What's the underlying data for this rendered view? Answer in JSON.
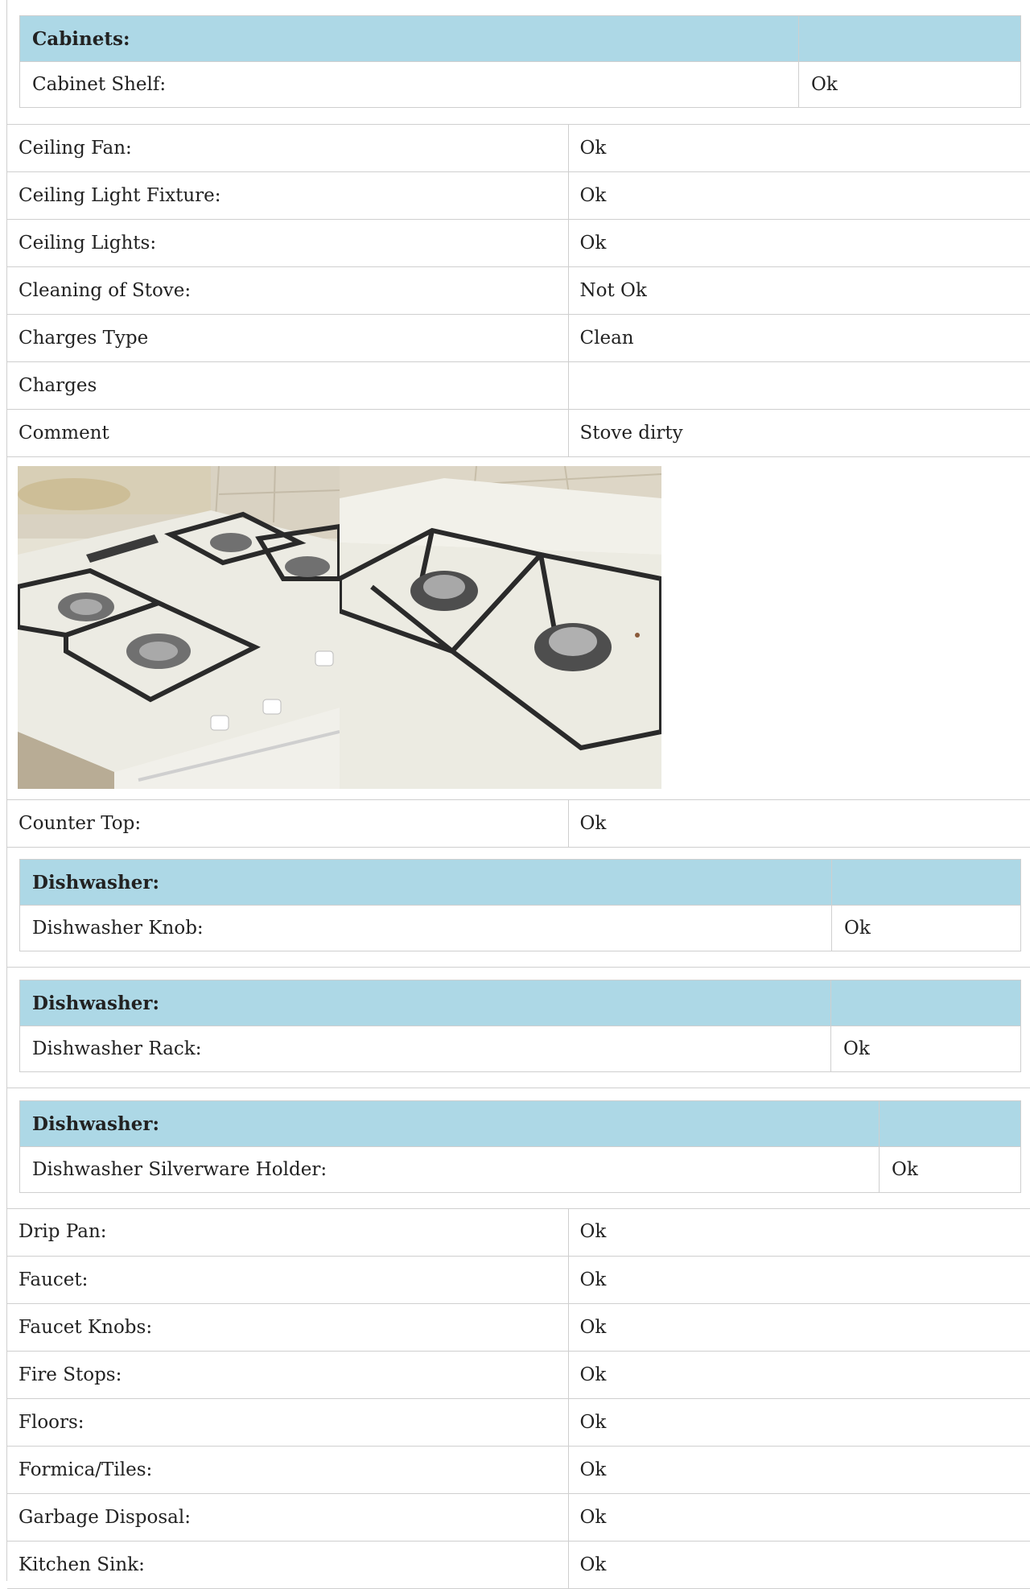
{
  "sections": {
    "cabinets": {
      "header": "Cabinets:",
      "row_label": "Cabinet Shelf:",
      "row_value": "Ok"
    },
    "dishwasher_knob": {
      "header": "Dishwasher:",
      "row_label": "Dishwasher Knob:",
      "row_value": "Ok"
    },
    "dishwasher_rack": {
      "header": "Dishwasher:",
      "row_label": "Dishwasher Rack:",
      "row_value": "Ok"
    },
    "dishwasher_silverware": {
      "header": "Dishwasher:",
      "row_label": "Dishwasher Silverware Holder:",
      "row_value": "Ok"
    }
  },
  "rows_a": [
    {
      "label": "Ceiling Fan:",
      "value": "Ok"
    },
    {
      "label": "Ceiling Light Fixture:",
      "value": "Ok"
    },
    {
      "label": "Ceiling Lights:",
      "value": "Ok"
    },
    {
      "label": "Cleaning of Stove:",
      "value": "Not Ok"
    },
    {
      "label": "Charges Type",
      "value": "Clean"
    },
    {
      "label": "Charges",
      "value": ""
    },
    {
      "label": "Comment",
      "value": "Stove dirty"
    }
  ],
  "row_counter": {
    "label": "Counter Top:",
    "value": "Ok"
  },
  "rows_b": [
    {
      "label": "Drip Pan:",
      "value": "Ok"
    },
    {
      "label": "Faucet:",
      "value": "Ok"
    },
    {
      "label": "Faucet Knobs:",
      "value": "Ok"
    },
    {
      "label": "Fire Stops:",
      "value": "Ok"
    },
    {
      "label": "Floors:",
      "value": "Ok"
    },
    {
      "label": "Formica/Tiles:",
      "value": "Ok"
    },
    {
      "label": "Garbage Disposal:",
      "value": "Ok"
    },
    {
      "label": "Kitchen Sink:",
      "value": "Ok"
    }
  ],
  "photos": [
    {
      "icon": "stove-photo-four-burners"
    },
    {
      "icon": "stove-photo-two-burners-closeup"
    }
  ],
  "colors": {
    "header_bg": "#add8e6",
    "border": "#cfcfcf",
    "text": "#222222"
  }
}
